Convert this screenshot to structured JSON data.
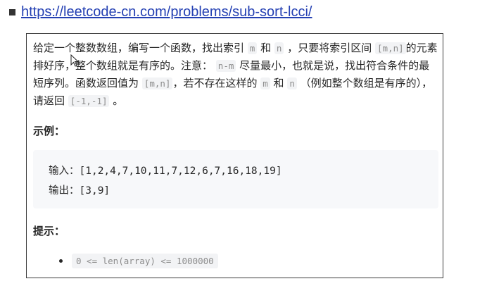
{
  "header": {
    "url": "https://leetcode-cn.com/problems/sub-sort-lcci/"
  },
  "description": {
    "p1": "给定一个整数数组，编写一个函数，找出索引",
    "m": "m",
    "p2": "和",
    "n": "n",
    "p3": "，只要将索引区间",
    "range_mn": "[m,n]",
    "p4": "的元素排好序，整个数组就是有序的。注意：",
    "n_minus_m": "n-m",
    "p5": "尽量最小，也就是说，找出符合条件的最短序列。函数返回值为",
    "range_mn2": "[m,n]",
    "p6": "，若不存在这样的",
    "m2": "m",
    "p7": "和",
    "n2": "n",
    "p8": "（例如整个数组是有序的），请返回",
    "neg_pair": "[-1,-1]",
    "p9": "。"
  },
  "example": {
    "title": "示例：",
    "input_label": "输入：",
    "input_value": "[1,2,4,7,10,11,7,12,6,7,16,18,19]",
    "output_label": "输出：",
    "output_value": "[3,9]"
  },
  "hints": {
    "title": "提示：",
    "items": [
      "0 <= len(array) <= 1000000"
    ]
  },
  "icons": {
    "bullet": "square-bullet-icon",
    "cursor": "mouse-pointer-icon"
  }
}
